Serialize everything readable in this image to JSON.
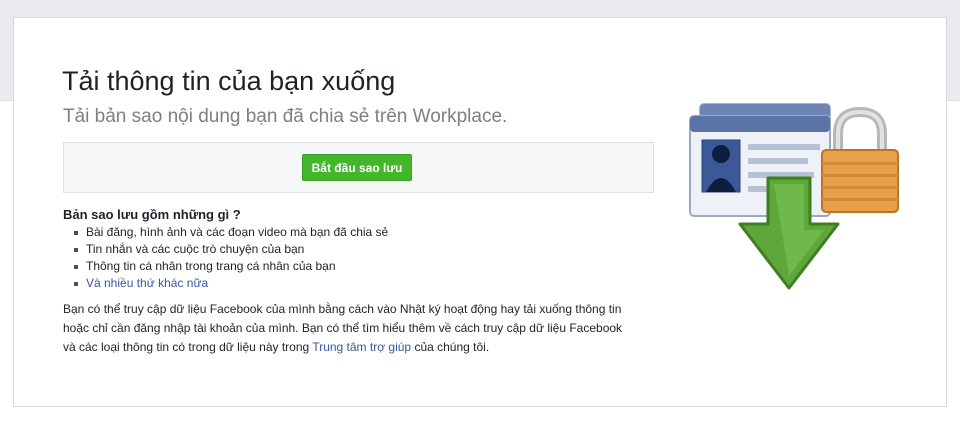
{
  "header": {
    "title": "Tải thông tin của bạn xuống",
    "subtitle": "Tải bản sao nội dung bạn đã chia sẻ trên Workplace."
  },
  "backup": {
    "button_label": "Bắt đầu sao lưu"
  },
  "includes": {
    "heading": "Bản sao lưu gồm những gì ?",
    "items": [
      "Bài đăng, hình ảnh và các đoạn video mà bạn đã chia sẻ",
      "Tin nhắn và các cuộc trò chuyện của bạn",
      "Thông tin cá nhân trong trang cá nhân của bạn"
    ],
    "more_link": "Và nhiều thứ khác nữa"
  },
  "info": {
    "text_line1": "Bạn có thể truy cập dữ liệu Facebook của mình bằng cách vào Nhật ký hoạt động hay tải xuống thông tin",
    "text_line2": "hoặc chỉ cần đăng nhập tài khoản của mình. Bạn có thể tìm hiểu thêm về cách truy cập dữ liệu Facebook",
    "text_line3_before": "và các loại thông tin có trong dữ liệu này trong ",
    "help_link": "Trung tâm trợ giúp",
    "text_line3_after": " của chúng tôi."
  },
  "illustration": {
    "icon": "download-profile-lock-icon"
  },
  "colors": {
    "accent_green": "#42b72a",
    "link_blue": "#365899",
    "page_bg": "#e9ebee"
  }
}
